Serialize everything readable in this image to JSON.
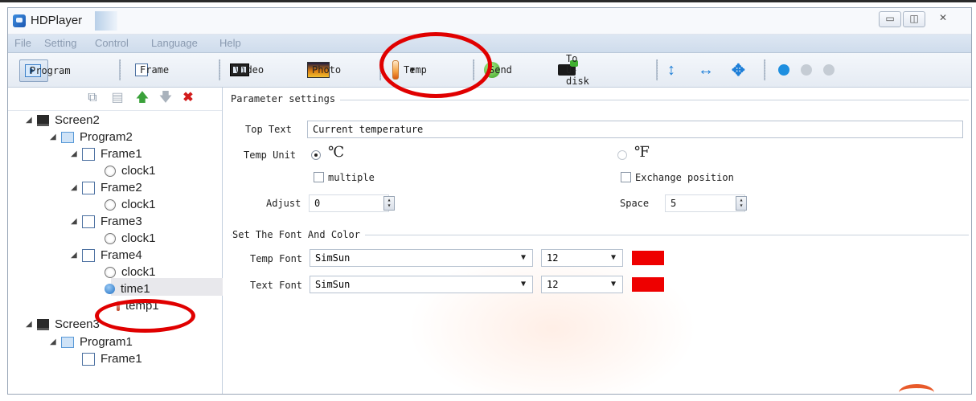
{
  "window": {
    "title": "HDPlayer"
  },
  "menu": [
    "File",
    "Setting",
    "Control",
    "Language",
    "Help"
  ],
  "toolbar": {
    "program": "Program",
    "frame": "Frame",
    "video": "Video",
    "photo": "Photo",
    "temp": "Temp",
    "send": "Send",
    "udisk": "To U-disk"
  },
  "tree": {
    "screen2": "Screen2",
    "program2": "Program2",
    "frame1": "Frame1",
    "clock1_a": "clock1",
    "frame2": "Frame2",
    "clock1_b": "clock1",
    "frame3": "Frame3",
    "clock1_c": "clock1",
    "frame4": "Frame4",
    "clock1_d": "clock1",
    "time1": "time1",
    "temp1": "temp1",
    "screen3": "Screen3",
    "program1": "Program1",
    "frame1b": "Frame1"
  },
  "params": {
    "group_title": "Parameter settings",
    "top_text_label": "Top Text",
    "top_text_value": "Current temperature",
    "temp_unit_label": "Temp Unit",
    "unit_c": "℃",
    "unit_f": "℉",
    "multiple": "multiple",
    "exchange": "Exchange position",
    "adjust_label": "Adjust",
    "adjust_value": "0",
    "space_label": "Space",
    "space_value": "5"
  },
  "font": {
    "group_title": "Set The Font And Color",
    "temp_font_label": "Temp Font",
    "temp_font_value": "SimSun",
    "temp_size": "12",
    "text_font_label": "Text Font",
    "text_font_value": "SimSun",
    "text_size": "12",
    "temp_color": "#ee0000",
    "text_color": "#ee0000"
  }
}
